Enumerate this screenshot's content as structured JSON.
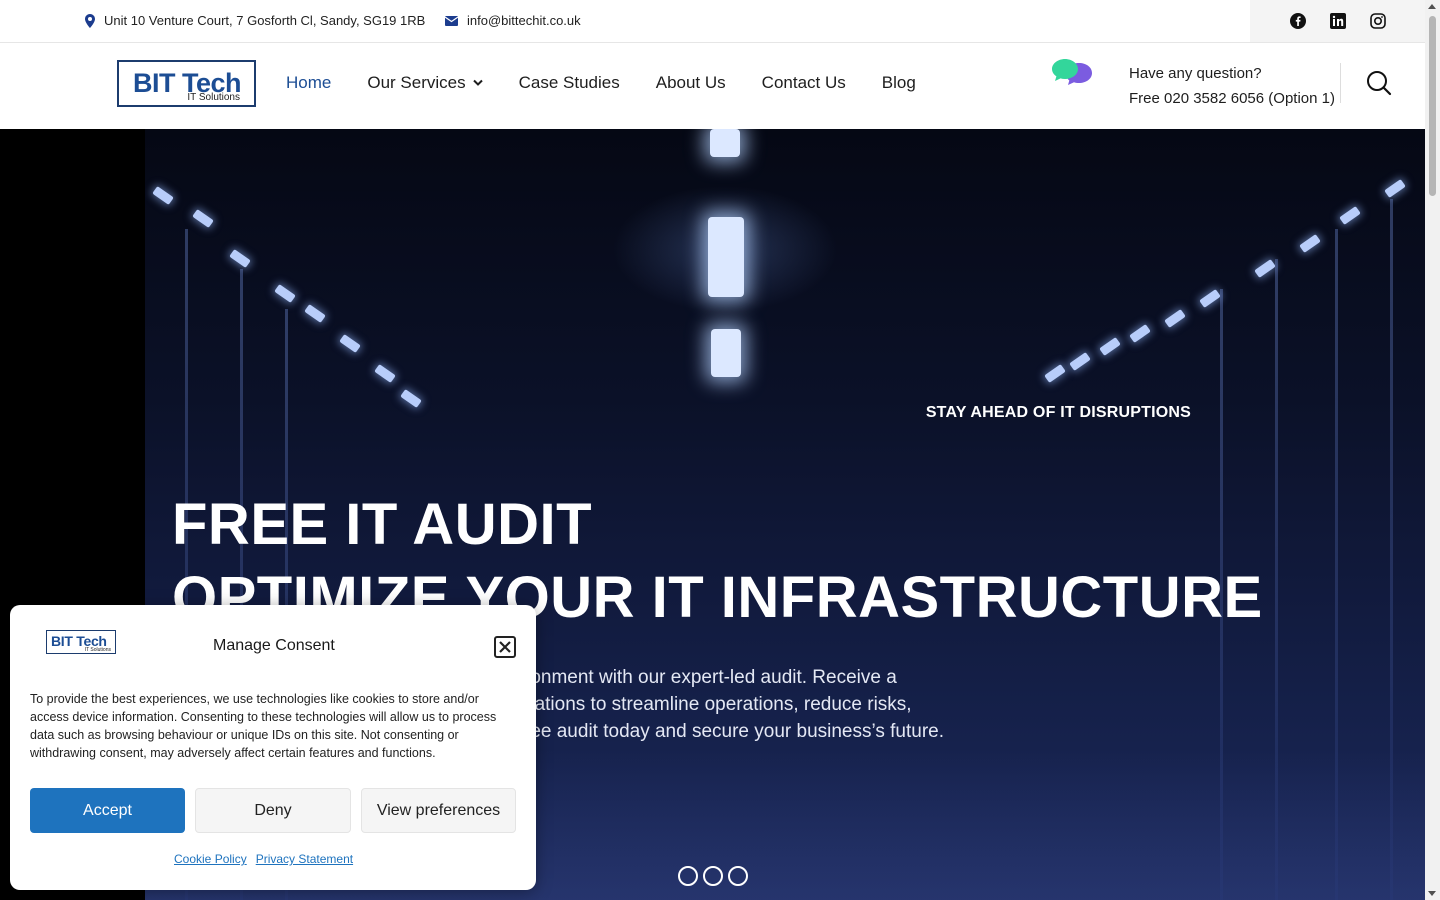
{
  "topbar": {
    "address": "Unit 10 Venture Court, 7 Gosforth Cl, Sandy, SG19 1RB",
    "email": "info@bittechit.co.uk",
    "social_icons": [
      "facebook-icon",
      "linkedin-icon",
      "instagram-icon"
    ]
  },
  "header": {
    "logo_main": "BIT Tech",
    "logo_sub": "IT Solutions",
    "nav": [
      {
        "label": "Home",
        "active": true
      },
      {
        "label": "Our Services",
        "has_dropdown": true
      },
      {
        "label": "Case Studies"
      },
      {
        "label": "About Us"
      },
      {
        "label": "Contact Us"
      },
      {
        "label": "Blog"
      }
    ],
    "question_label": "Have any question?",
    "phone": "Free 020 3582 6056 (Option 1)"
  },
  "hero": {
    "eyebrow": "STAY AHEAD OF IT DISRUPTIONS",
    "headline_1": "FREE IT AUDIT",
    "headline_2": "OPTIMIZE YOUR IT INFRASTRUCTURE",
    "lead_line_1": "ronment with our expert-led audit. Receive a",
    "lead_line_2": "dations to streamline operations, reduce risks,",
    "lead_line_3": "ree audit today and secure your business’s future.",
    "slides_count": 3
  },
  "consent": {
    "logo_main": "BIT Tech",
    "logo_sub": "IT Solutions",
    "title": "Manage Consent",
    "body": "To provide the best experiences, we use technologies like cookies to store and/or access device information. Consenting to these technologies will allow us to process data such as browsing behaviour or unique IDs on this site. Not consenting or withdrawing consent, may adversely affect certain features and functions.",
    "accept_label": "Accept",
    "deny_label": "Deny",
    "preferences_label": "View preferences",
    "cookie_policy_label": "Cookie Policy",
    "privacy_label": "Privacy Statement"
  },
  "colors": {
    "brand_blue": "#1c4d94",
    "accept_blue": "#1e73be",
    "hero_dark": "#0b1128"
  }
}
